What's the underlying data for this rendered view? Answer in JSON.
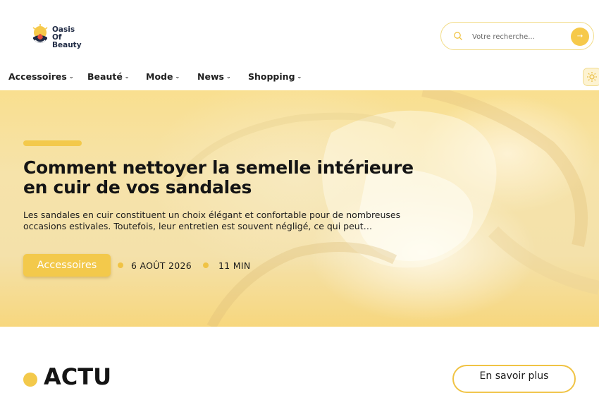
{
  "brand": {
    "logo_lines": [
      "Oasis",
      "Of",
      "Beauty"
    ]
  },
  "search": {
    "placeholder": "Votre recherche...",
    "button_icon": "→"
  },
  "nav": {
    "items": [
      {
        "label": "Accessoires"
      },
      {
        "label": "Beauté"
      },
      {
        "label": "Mode"
      },
      {
        "label": "News"
      },
      {
        "label": "Shopping"
      }
    ],
    "theme_toggle_icon": "sun-icon"
  },
  "hero": {
    "title": "Comment nettoyer la semelle intérieure en cuir de vos sandales",
    "excerpt": "Les sandales en cuir constituent un choix élégant et confortable pour de nombreuses occasions estivales. Toutefois, leur entretien est souvent négligé, ce qui peut…",
    "category": "Accessoires",
    "date": "6 AOÛT 2026",
    "read_time": "11 MIN"
  },
  "section": {
    "title": "ACTU",
    "more_label": "En savoir plus"
  },
  "colors": {
    "accent": "#f3c94b",
    "text": "#141414"
  }
}
